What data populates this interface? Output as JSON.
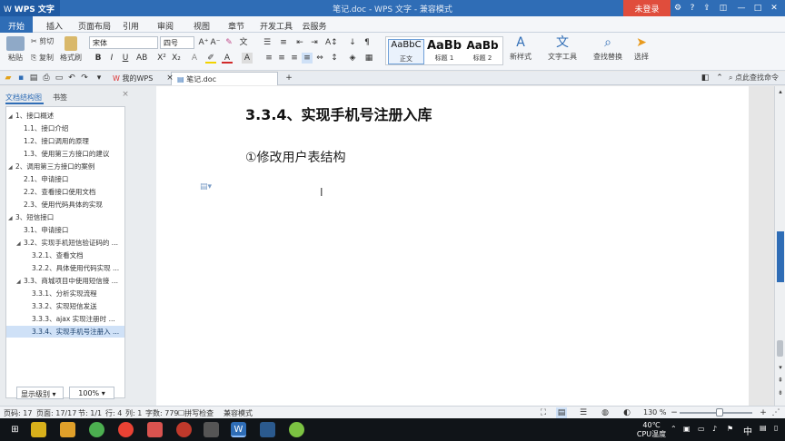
{
  "window": {
    "app_badge": "WPS 文字",
    "title": "笔记.doc - WPS 文字 - 兼容模式",
    "login_button": "未登录",
    "controls": [
      "minimize-icon",
      "maximize-icon",
      "close-icon"
    ]
  },
  "menu": {
    "tabs": [
      "开始",
      "插入",
      "页面布局",
      "引用",
      "审阅",
      "视图",
      "章节",
      "开发工具",
      "云服务"
    ],
    "active_index": 0
  },
  "ribbon": {
    "paste": "粘贴",
    "cut": "剪切",
    "copy": "复制",
    "format_painter": "格式刷",
    "font_name": "宋体",
    "font_size": "四号",
    "styles": [
      {
        "sample": "AaBbC",
        "name": "正文"
      },
      {
        "sample": "AaBb",
        "name": "标题 1"
      },
      {
        "sample": "AaBb",
        "name": "标题 2"
      }
    ],
    "new_style": "新样式",
    "text_tools": "文字工具",
    "find_replace": "查找替换",
    "select": "选择"
  },
  "tabbar": {
    "tabs": [
      "我的WPS",
      "笔记.doc"
    ],
    "active_index": 1,
    "search_placeholder": "点此查找命令"
  },
  "leftpane": {
    "tabs": [
      "文档结构图",
      "书签"
    ],
    "active_index": 0,
    "outline": [
      {
        "level": 1,
        "text": "1、接口概述",
        "caret": true
      },
      {
        "level": 2,
        "text": "1.1、接口介绍"
      },
      {
        "level": 2,
        "text": "1.2、接口调用的原理"
      },
      {
        "level": 2,
        "text": "1.3、使用第三方接口的建议"
      },
      {
        "level": 1,
        "text": "2、调用第三方接口的案例",
        "caret": true
      },
      {
        "level": 2,
        "text": "2.1、申请接口"
      },
      {
        "level": 2,
        "text": "2.2、查看接口使用文档"
      },
      {
        "level": 2,
        "text": "2.3、使用代码具体的实现"
      },
      {
        "level": 1,
        "text": "3、短信接口",
        "caret": true
      },
      {
        "level": 2,
        "text": "3.1、申请接口"
      },
      {
        "level": 2,
        "text": "3.2、实现手机短信验证码的 ...",
        "caret": true
      },
      {
        "level": 3,
        "text": "3.2.1、查看文档"
      },
      {
        "level": 3,
        "text": "3.2.2、具体使用代码实现 ..."
      },
      {
        "level": 2,
        "text": "3.3、商城项目中使用短信接 ...",
        "caret": true
      },
      {
        "level": 3,
        "text": "3.3.1、分析实现流程"
      },
      {
        "level": 3,
        "text": "3.3.2、实现短信发送"
      },
      {
        "level": 3,
        "text": "3.3.3、ajax 实现注册时 ..."
      },
      {
        "level": 3,
        "text": "3.3.4、实现手机号注册入 ...",
        "selected": true
      }
    ],
    "display_level": "显示级别",
    "zoom": "100%"
  },
  "document": {
    "heading": "3.3.4、实现手机号注册入库",
    "paragraph": "①修改用户表结构"
  },
  "status": {
    "page": "页码: 17",
    "pages": "页面: 17/17",
    "section": "节: 1/1",
    "row": "行: 4",
    "col": "列: 1",
    "words": "字数: 779",
    "spell": "拼写检查",
    "compat": "兼容模式",
    "zoom": "130 %",
    "zoom_fraction": 0.55
  },
  "taskbar": {
    "temp": "40℃",
    "temp_label": "CPU温度",
    "ime": "中"
  },
  "colors": {
    "accent": "#2f6db6",
    "login": "#e04d3c"
  }
}
